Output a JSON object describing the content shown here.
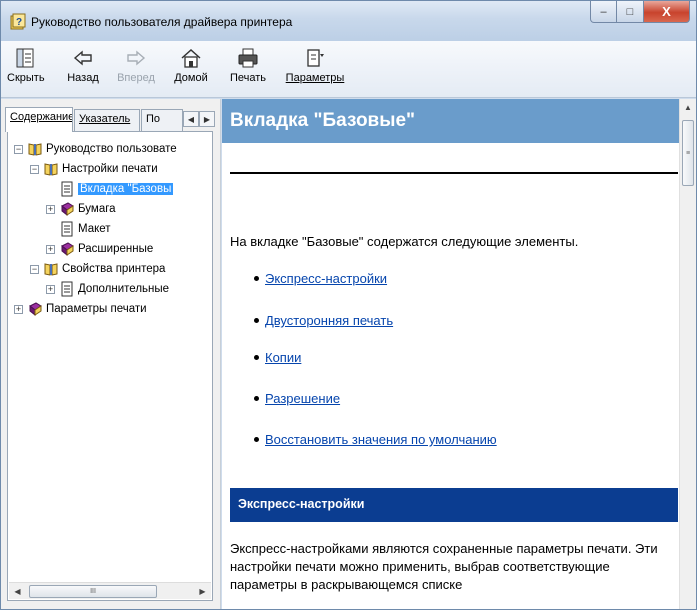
{
  "window": {
    "title": "Руководство пользователя драйвера принтера",
    "controls": {
      "minimize": "–",
      "maximize": "□",
      "close": "X"
    }
  },
  "toolbar": {
    "hide": "Скрыть",
    "back": "Назад",
    "forward": "Вперед",
    "home": "Домой",
    "print": "Печать",
    "options": "Параметры"
  },
  "tabs": {
    "contents": "Содержание",
    "index": "Указатель",
    "search": "По"
  },
  "tree": {
    "root": "Руководство пользовате",
    "print_settings": "Настройки печати",
    "basic_tab": "Вкладка \"Базовы",
    "paper": "Бумага",
    "layout": "Макет",
    "advanced": "Расширенные",
    "printer_props": "Свойства принтера",
    "additional": "Дополнительные",
    "print_params": "Параметры печати"
  },
  "scroll": {
    "grip": "III",
    "vgrip": "≡"
  },
  "content": {
    "heading": "Вкладка \"Базовые\"",
    "intro": "На вкладке \"Базовые\" содержатся следующие элементы.",
    "links": [
      "Экспресс-настройки",
      "Двусторонняя печать",
      "Копии",
      "Разрешение",
      "Восстановить значения по умолчанию"
    ],
    "section_title": "Экспресс-настройки",
    "paragraph": "Экспресс-настройками являются сохраненные параметры печати. Эти настройки печати можно применить, выбрав соответствующие параметры в раскрывающемся списке"
  },
  "colors": {
    "heading_bar": "#6a9ccb",
    "section_bar": "#0b3d91",
    "link": "#0645ad",
    "selection": "#3399ff"
  },
  "icons": {
    "title": "help-book-icon",
    "hide": "hide-pane-icon",
    "back": "back-arrow-icon",
    "forward": "forward-arrow-icon",
    "home": "home-icon",
    "print": "printer-icon",
    "options": "options-icon",
    "book_open": "open-book-icon",
    "book_closed": "closed-book-icon",
    "page": "page-icon"
  }
}
